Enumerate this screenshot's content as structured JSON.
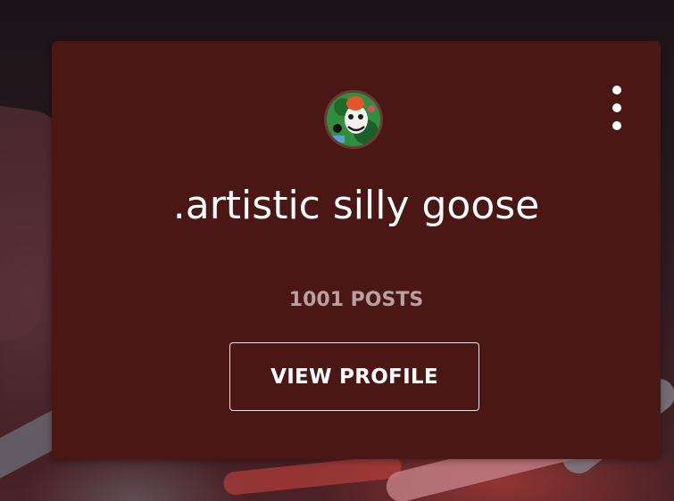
{
  "card": {
    "title": ".artistic silly goose",
    "posts_count": "1001 POSTS",
    "view_button_label": "VIEW PROFILE",
    "menu_icon": "more-vertical-icon",
    "avatar_icon": "avatar-image"
  },
  "colors": {
    "card_background": "#4a1715",
    "title_text": "#ffffff",
    "posts_text": "#b9a19e",
    "button_border": "#f2e6e4"
  }
}
